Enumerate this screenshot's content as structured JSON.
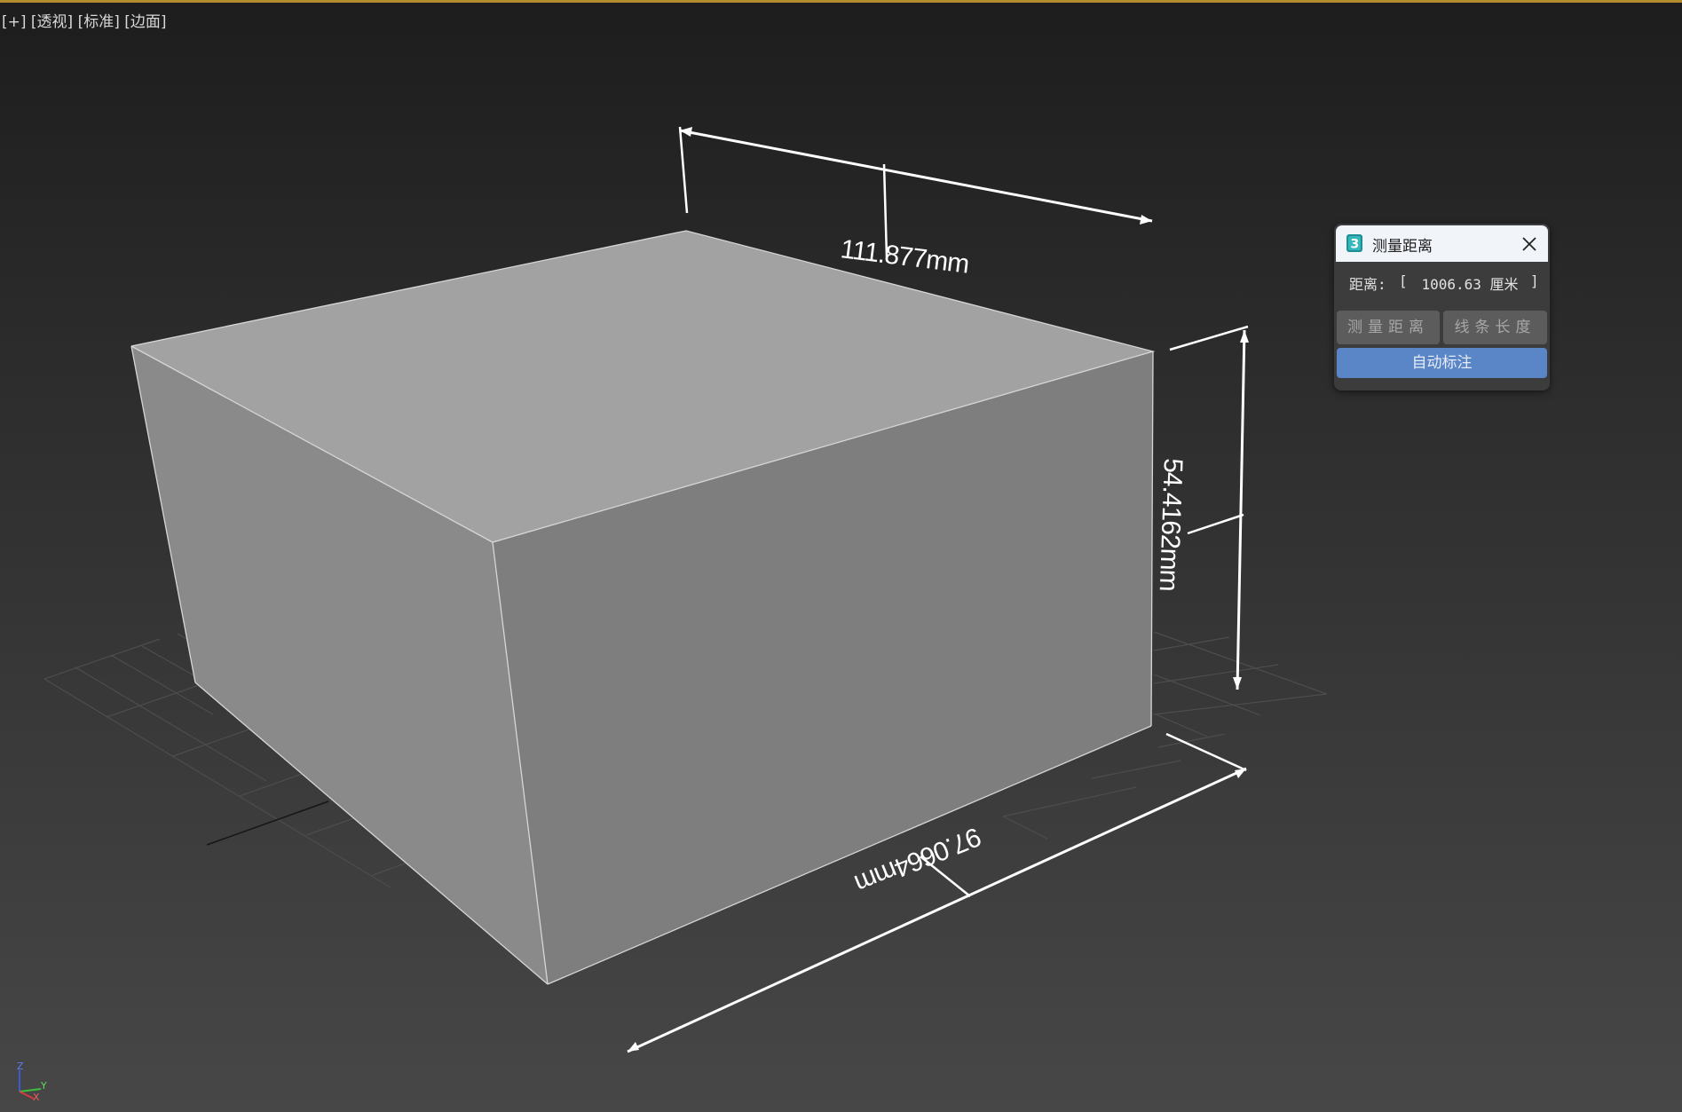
{
  "viewport": {
    "labels": [
      "[+]",
      "[透视]",
      "[标准]",
      "[边面]"
    ]
  },
  "dimensions": {
    "width": "111.877mm",
    "height": "54.4162mm",
    "depth": "97.0664mm"
  },
  "measure_dialog": {
    "title": "测量距离",
    "distance_label": "距离:",
    "bracket_open": "[",
    "distance_value": "1006.63 厘米",
    "bracket_close": "]",
    "measure_distance_button": "测量距离",
    "line_length_button": "线条长度",
    "auto_annotate_button": "自动标注"
  },
  "axis": {
    "z": "Z",
    "y": "Y",
    "x": "X"
  },
  "colors": {
    "accent_border": "#b38a2e",
    "primary_button": "#5a85c6",
    "axis_x": "#d23c3c",
    "axis_y": "#3cbf3c",
    "axis_z": "#3c5cd2"
  }
}
